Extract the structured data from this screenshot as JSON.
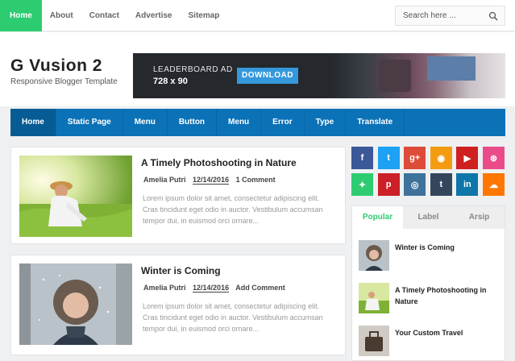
{
  "topnav": {
    "items": [
      "Home",
      "About",
      "Contact",
      "Advertise",
      "Sitemap"
    ]
  },
  "search": {
    "placeholder": "Search here ..."
  },
  "site": {
    "title": "G Vusion 2",
    "tagline": "Responsive Blogger Template"
  },
  "ad": {
    "label": "LEADERBOARD AD",
    "size": "728 x 90",
    "button": "DOWNLOAD"
  },
  "mainnav": {
    "items": [
      "Home",
      "Static Page",
      "Menu",
      "Button",
      "Menu",
      "Error",
      "Type",
      "Translate"
    ]
  },
  "posts": [
    {
      "title": "A Timely Photoshooting in Nature",
      "author": "Amelia Putri",
      "date": "12/14/2016",
      "comments": "1 Comment",
      "excerpt": "Lorem ipsum dolor sit amet, consectetur adipiscing elit. Cras tincidunt eget odio in auctor. Vestibulum accumsan tempor dui, in euismod orci ornare..."
    },
    {
      "title": "Winter is Coming",
      "author": "Amelia Putri",
      "date": "12/14/2016",
      "comments": "Add Comment",
      "excerpt": "Lorem ipsum dolor sit amet, consectetur adipiscing elit. Cras tincidunt eget odio in auctor. Vestibulum accumsan tempor dui, in euismod orci ornare..."
    }
  ],
  "social": [
    {
      "icon": "facebook-icon",
      "glyph": "f",
      "color": "#3b5998"
    },
    {
      "icon": "twitter-icon",
      "glyph": "t",
      "color": "#1da1f2"
    },
    {
      "icon": "google-plus-icon",
      "glyph": "g+",
      "color": "#dd4b39"
    },
    {
      "icon": "rss-icon",
      "glyph": "◉",
      "color": "#f39c12"
    },
    {
      "icon": "youtube-icon",
      "glyph": "▶",
      "color": "#cd201f"
    },
    {
      "icon": "dribbble-icon",
      "glyph": "⊛",
      "color": "#ea4c89"
    },
    {
      "icon": "delicious-icon",
      "glyph": "✦",
      "color": "#2ecc71"
    },
    {
      "icon": "pinterest-icon",
      "glyph": "p",
      "color": "#cb2027"
    },
    {
      "icon": "instagram-icon",
      "glyph": "◎",
      "color": "#3f729b"
    },
    {
      "icon": "tumblr-icon",
      "glyph": "t",
      "color": "#35465c"
    },
    {
      "icon": "linkedin-icon",
      "glyph": "in",
      "color": "#0e76a8"
    },
    {
      "icon": "soundcloud-icon",
      "glyph": "☁",
      "color": "#ff7700"
    }
  ],
  "sidebar": {
    "tabs": [
      "Popular",
      "Label",
      "Arsip"
    ],
    "popular": [
      "Winter is Coming",
      "A Timely Photoshooting in Nature",
      "Your Custom Travel"
    ]
  },
  "colors": {
    "accent": "#2ecc71",
    "nav": "#0b72b7"
  }
}
